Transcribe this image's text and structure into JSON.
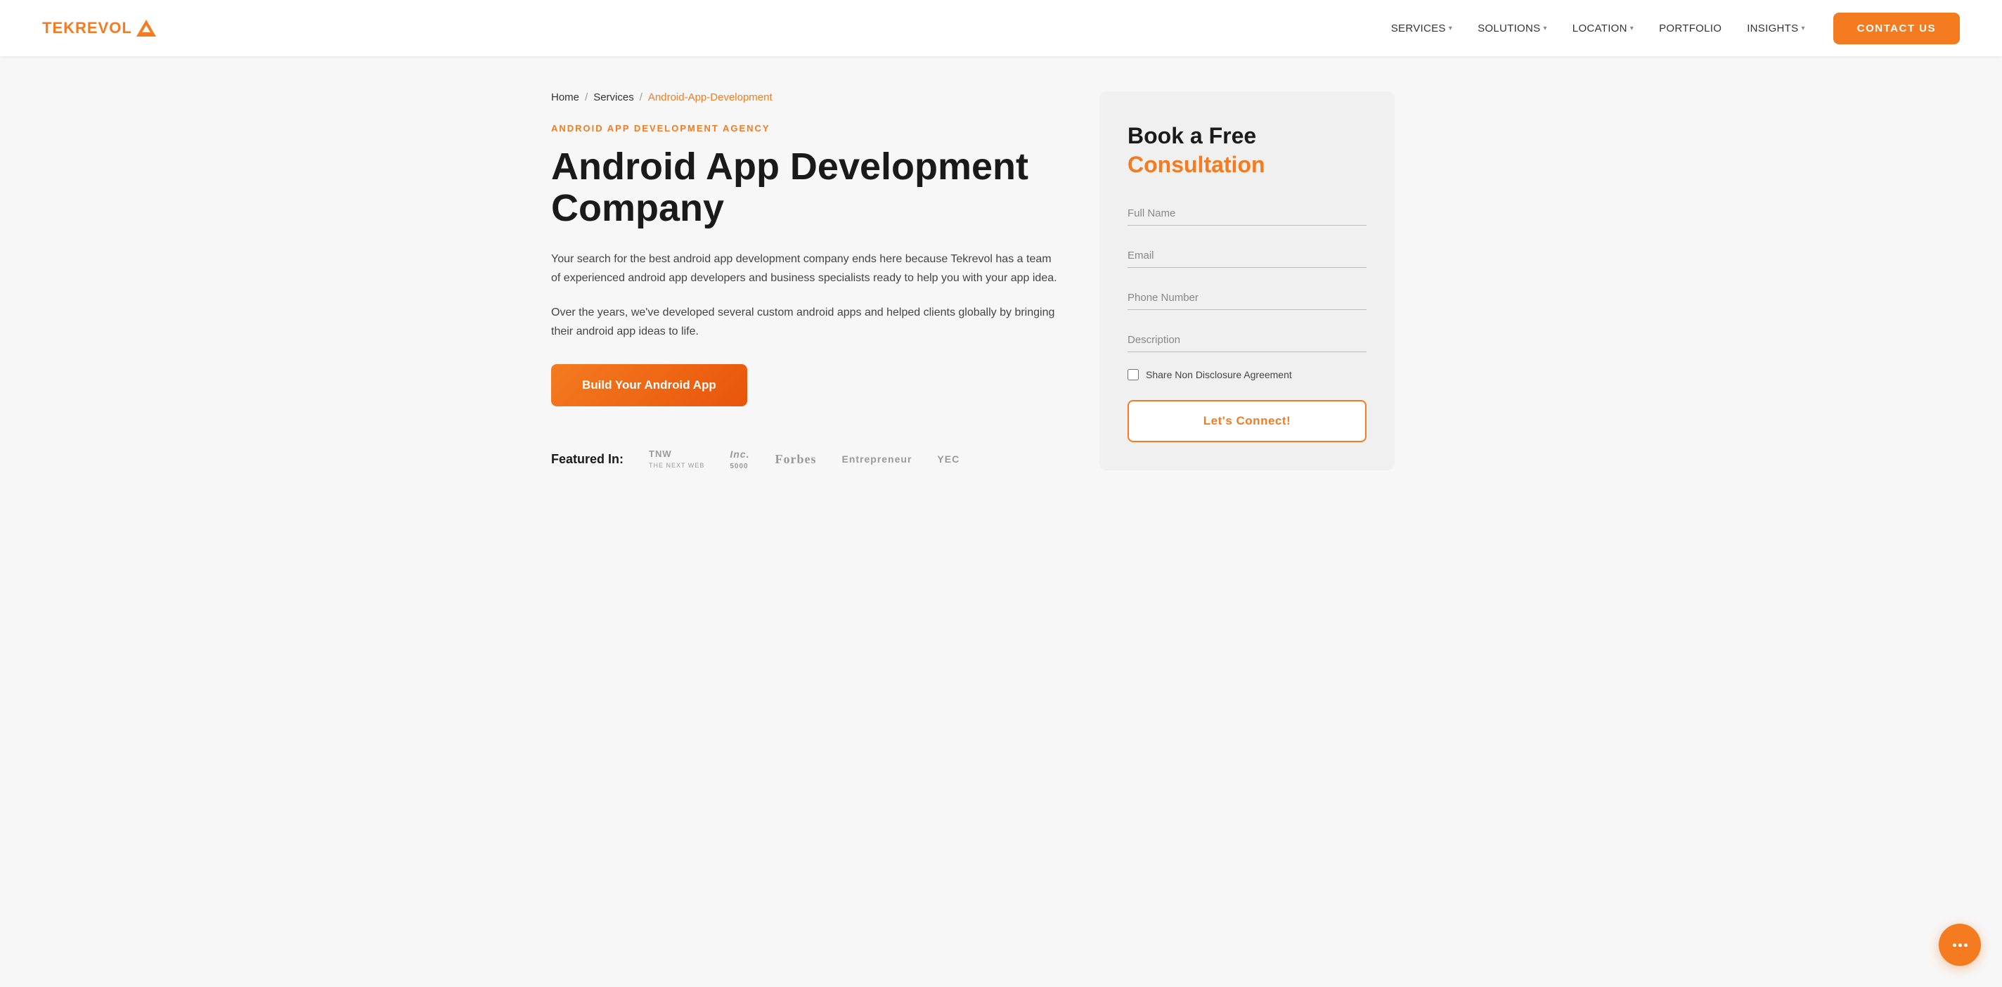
{
  "nav": {
    "logo_text_1": "TEK",
    "logo_text_2": "REVOL",
    "links": [
      {
        "label": "SERVICES",
        "has_dropdown": true
      },
      {
        "label": "SOLUTIONS",
        "has_dropdown": true
      },
      {
        "label": "LOCATION",
        "has_dropdown": true
      },
      {
        "label": "PORTFOLIO",
        "has_dropdown": false
      },
      {
        "label": "INSIGHTS",
        "has_dropdown": true
      }
    ],
    "contact_label": "CONTACT US"
  },
  "breadcrumb": {
    "home": "Home",
    "sep1": "/",
    "services": "Services",
    "sep2": "/",
    "current": "Android-App-Development"
  },
  "hero": {
    "agency_label": "ANDROID APP DEVELOPMENT AGENCY",
    "title_line1": "Android App Development",
    "title_line2": "Company",
    "desc1": "Your search for the best android app development company ends here because Tekrevol has a team of experienced android app developers and business specialists ready to help you with your app idea.",
    "desc2": "Over the years, we've developed several custom android apps and helped clients globally by bringing their android app ideas to life.",
    "cta_button": "Build Your Android App"
  },
  "featured": {
    "label": "Featured In:",
    "logos": [
      {
        "text": "TNW THE NEXT WEB",
        "id": "tnw"
      },
      {
        "text": "Inc. 5000",
        "id": "inc"
      },
      {
        "text": "Forbes",
        "id": "forbes"
      },
      {
        "text": "Entrepreneur",
        "id": "entrepreneur"
      },
      {
        "text": "YEC",
        "id": "yec"
      }
    ]
  },
  "form": {
    "title_line1": "Book a Free",
    "title_line2": "Consultation",
    "full_name_placeholder": "Full Name",
    "email_placeholder": "Email",
    "phone_placeholder": "Phone Number",
    "description_placeholder": "Description",
    "nda_label": "Share Non Disclosure Agreement",
    "connect_button": "Let's Connect!"
  },
  "colors": {
    "orange": "#f47b20",
    "dark": "#1a1a1a",
    "gray": "#f0f0f0"
  }
}
